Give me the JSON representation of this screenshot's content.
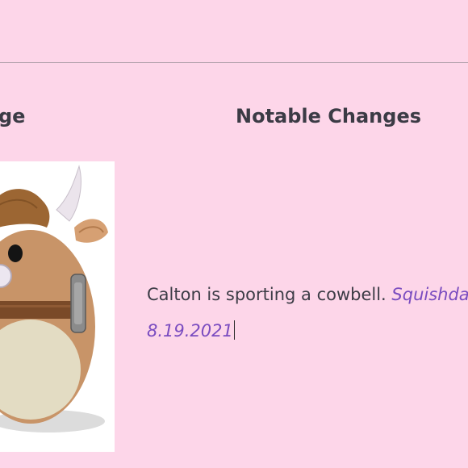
{
  "table": {
    "left_heading_partial": "ge",
    "right_heading": "Notable Changes",
    "photo_alt": "Calton the highland cow squishmallow plush",
    "changes_text": "Calton is sporting a cowbell. ",
    "credit_text": "Squishdat",
    "date_text": "8.19.2021"
  },
  "colors": {
    "background": "#fdd6e9",
    "heading": "#3b3b45",
    "body_text": "#3c3c46",
    "accent_purple": "#7a4cc0",
    "plush_tan": "#c89468",
    "plush_belly": "#e3dcc3",
    "plush_horn": "#ebe4ec"
  }
}
